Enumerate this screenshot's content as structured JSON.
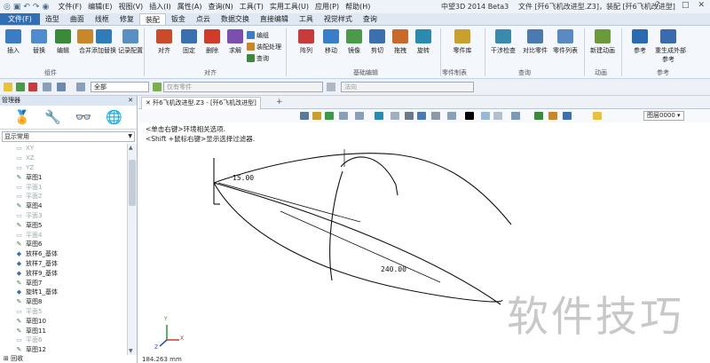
{
  "titlebar": {
    "quick_access": [
      "◎",
      "▣",
      "↶",
      "↷",
      "◉"
    ],
    "menu": [
      "文件(F)",
      "编辑(E)",
      "视图(V)",
      "插入(I)",
      "属性(A)",
      "查询(N)",
      "工具(T)",
      "实用工具(U)",
      "应用(P)",
      "帮助(H)"
    ],
    "app_title": "中望3D 2014 Beta3",
    "doc_section": "文件 [歼6飞机改进型.Z3]，装配 [歼6飞机改进型]",
    "controls": [
      "?",
      "–",
      "□",
      "✕"
    ]
  },
  "tabs": [
    "文件(F)",
    "造型",
    "曲面",
    "线框",
    "修复",
    "装配",
    "钣金",
    "点云",
    "数据交换",
    "直接编辑",
    "工具",
    "视觉样式",
    "查询"
  ],
  "ribbon": {
    "buttons": [
      {
        "label": "插入",
        "icon": "insert-icon",
        "color": "#3b7cc4"
      },
      {
        "label": "替换",
        "icon": "replace-icon",
        "color": "#4f8bd0"
      },
      {
        "label": "编辑",
        "icon": "edit-icon",
        "color": "#3a8a3a"
      },
      {
        "label": "合并",
        "icon": "merge-icon",
        "color": "#c9872a"
      },
      {
        "label": "添加替换",
        "icon": "add-replace-icon",
        "color": "#2e7db8"
      },
      {
        "label": "记录配置",
        "icon": "record-config-icon",
        "color": "#5a8fc4"
      },
      {
        "label": "对齐",
        "icon": "align-icon",
        "color": "#c94b2a"
      },
      {
        "label": "固定",
        "icon": "fix-icon",
        "color": "#3a6fb0"
      },
      {
        "label": "删除",
        "icon": "delete-icon",
        "color": "#d03b2a"
      },
      {
        "label": "求解",
        "icon": "solve-icon",
        "color": "#7a4fb0"
      },
      {
        "label": "阵列",
        "icon": "array-icon",
        "color": "#c93a3a"
      },
      {
        "label": "移动",
        "icon": "move-icon",
        "color": "#3a7ec9"
      },
      {
        "label": "镜像",
        "icon": "mirror-icon",
        "color": "#4a9a4a"
      },
      {
        "label": "剪切",
        "icon": "cut-icon",
        "color": "#3a6fb0"
      },
      {
        "label": "拖拽",
        "icon": "drag-icon",
        "color": "#c96a2a"
      },
      {
        "label": "旋转",
        "icon": "rotate-icon",
        "color": "#2a8ab0"
      },
      {
        "label": "零件库",
        "icon": "part-library-icon",
        "color": "#c9a02a"
      },
      {
        "label": "干涉检查",
        "icon": "interference-check-icon",
        "color": "#3a8ab0"
      },
      {
        "label": "对比零件",
        "icon": "compare-part-icon",
        "color": "#4a7ab0"
      },
      {
        "label": "零件列表",
        "icon": "part-list-icon",
        "color": "#5a8ac4"
      },
      {
        "label": "新建动画",
        "icon": "new-animation-icon",
        "color": "#6a9a3a"
      },
      {
        "label": "参考",
        "icon": "reference-icon",
        "color": "#2a6ab0"
      },
      {
        "label": "重生成外部\n参考",
        "icon": "regen-ref-icon",
        "color": "#3a6ab0"
      }
    ],
    "small_buttons": [
      {
        "label": "编组",
        "icon": "group-icon",
        "color": "#3a7ec9"
      },
      {
        "label": "装配处理",
        "icon": "assembly-process-icon",
        "color": "#c9872a"
      },
      {
        "label": "查询",
        "icon": "query-icon",
        "color": "#3a8a3a"
      }
    ],
    "groups": [
      "组件",
      "对齐",
      "基础编辑",
      "零件制表",
      "查询",
      "动画",
      "参考"
    ]
  },
  "toolbar2": {
    "filter_value": "全部",
    "part_filter": "仅有零件",
    "normal_filter": "法向"
  },
  "manager": {
    "title": "管理器",
    "close": "✕",
    "display_filter": "显示常用",
    "tree": [
      {
        "label": "XY",
        "type": "plane"
      },
      {
        "label": "XZ",
        "type": "plane"
      },
      {
        "label": "YZ",
        "type": "plane"
      },
      {
        "label": "草图1",
        "type": "sketch"
      },
      {
        "label": "平面1",
        "type": "plane"
      },
      {
        "label": "平面2",
        "type": "plane"
      },
      {
        "label": "草图4",
        "type": "sketch"
      },
      {
        "label": "平面3",
        "type": "plane"
      },
      {
        "label": "草图5",
        "type": "sketch"
      },
      {
        "label": "平面4",
        "type": "plane"
      },
      {
        "label": "草图6",
        "type": "sketch"
      },
      {
        "label": "放样6_基体",
        "type": "feature"
      },
      {
        "label": "放样7_基体",
        "type": "feature"
      },
      {
        "label": "放样9_基体",
        "type": "feature"
      },
      {
        "label": "草图7",
        "type": "sketch"
      },
      {
        "label": "旋转1_基体",
        "type": "feature"
      },
      {
        "label": "草图8",
        "type": "sketch"
      },
      {
        "label": "平面5",
        "type": "plane"
      },
      {
        "label": "草图10",
        "type": "sketch"
      },
      {
        "label": "草图11",
        "type": "sketch"
      },
      {
        "label": "平面6",
        "type": "plane"
      },
      {
        "label": "草图12",
        "type": "sketch"
      }
    ],
    "footer": "回收"
  },
  "document": {
    "tab": "歼6飞机改进型.Z3 - [歼6飞机改进型]",
    "add_tab": "+"
  },
  "view_toolbar": {
    "layer": "图层0000"
  },
  "viewport": {
    "hint1": "<单击右键>环境相关选项.",
    "hint2": "<Shift +鼠标右键>显示选择过滤器.",
    "dim_small": "15.00",
    "dim_large": "240.00",
    "watermark": "软件技巧",
    "axis_x": "X",
    "axis_y": "Y",
    "axis_z": "Z",
    "coordinate": "184.263 mm"
  }
}
